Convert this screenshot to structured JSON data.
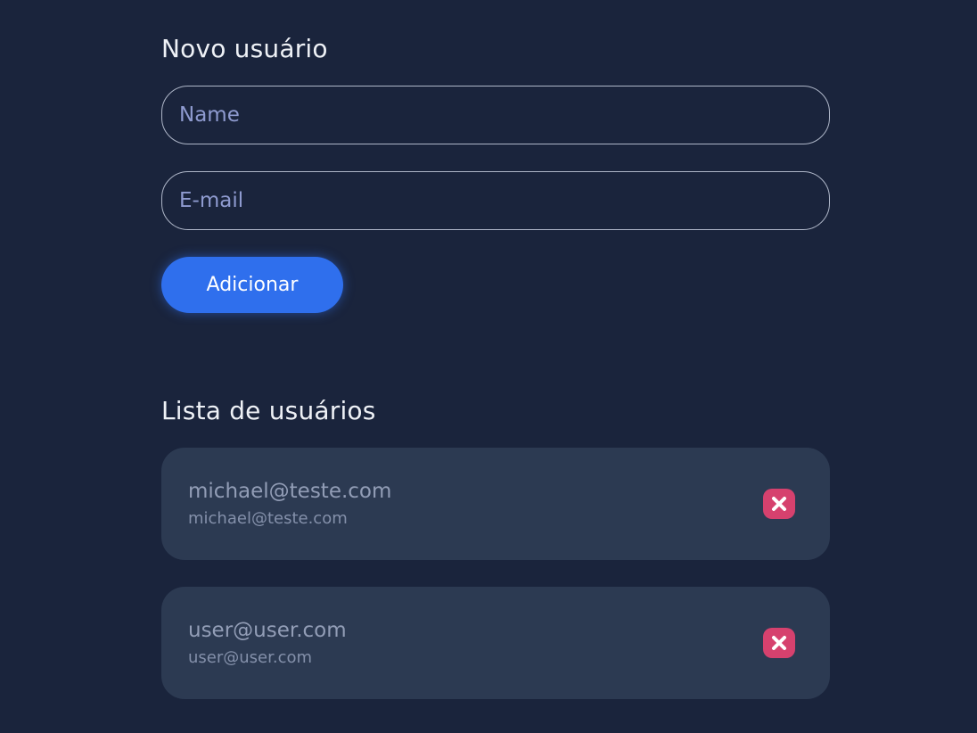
{
  "form": {
    "title": "Novo usuário",
    "name_placeholder": "Name",
    "name_value": "",
    "email_placeholder": "E-mail",
    "email_value": "",
    "add_label": "Adicionar"
  },
  "list": {
    "title": "Lista de usuários",
    "users": [
      {
        "name": "michael@teste.com",
        "email": "michael@teste.com",
        "remove_icon": "close-icon"
      },
      {
        "name": "user@user.com",
        "email": "user@user.com",
        "remove_icon": "close-icon"
      }
    ]
  },
  "colors": {
    "background": "#1a243c",
    "card": "#2c3a52",
    "accent": "#2f6fed",
    "danger": "#d6416e"
  }
}
